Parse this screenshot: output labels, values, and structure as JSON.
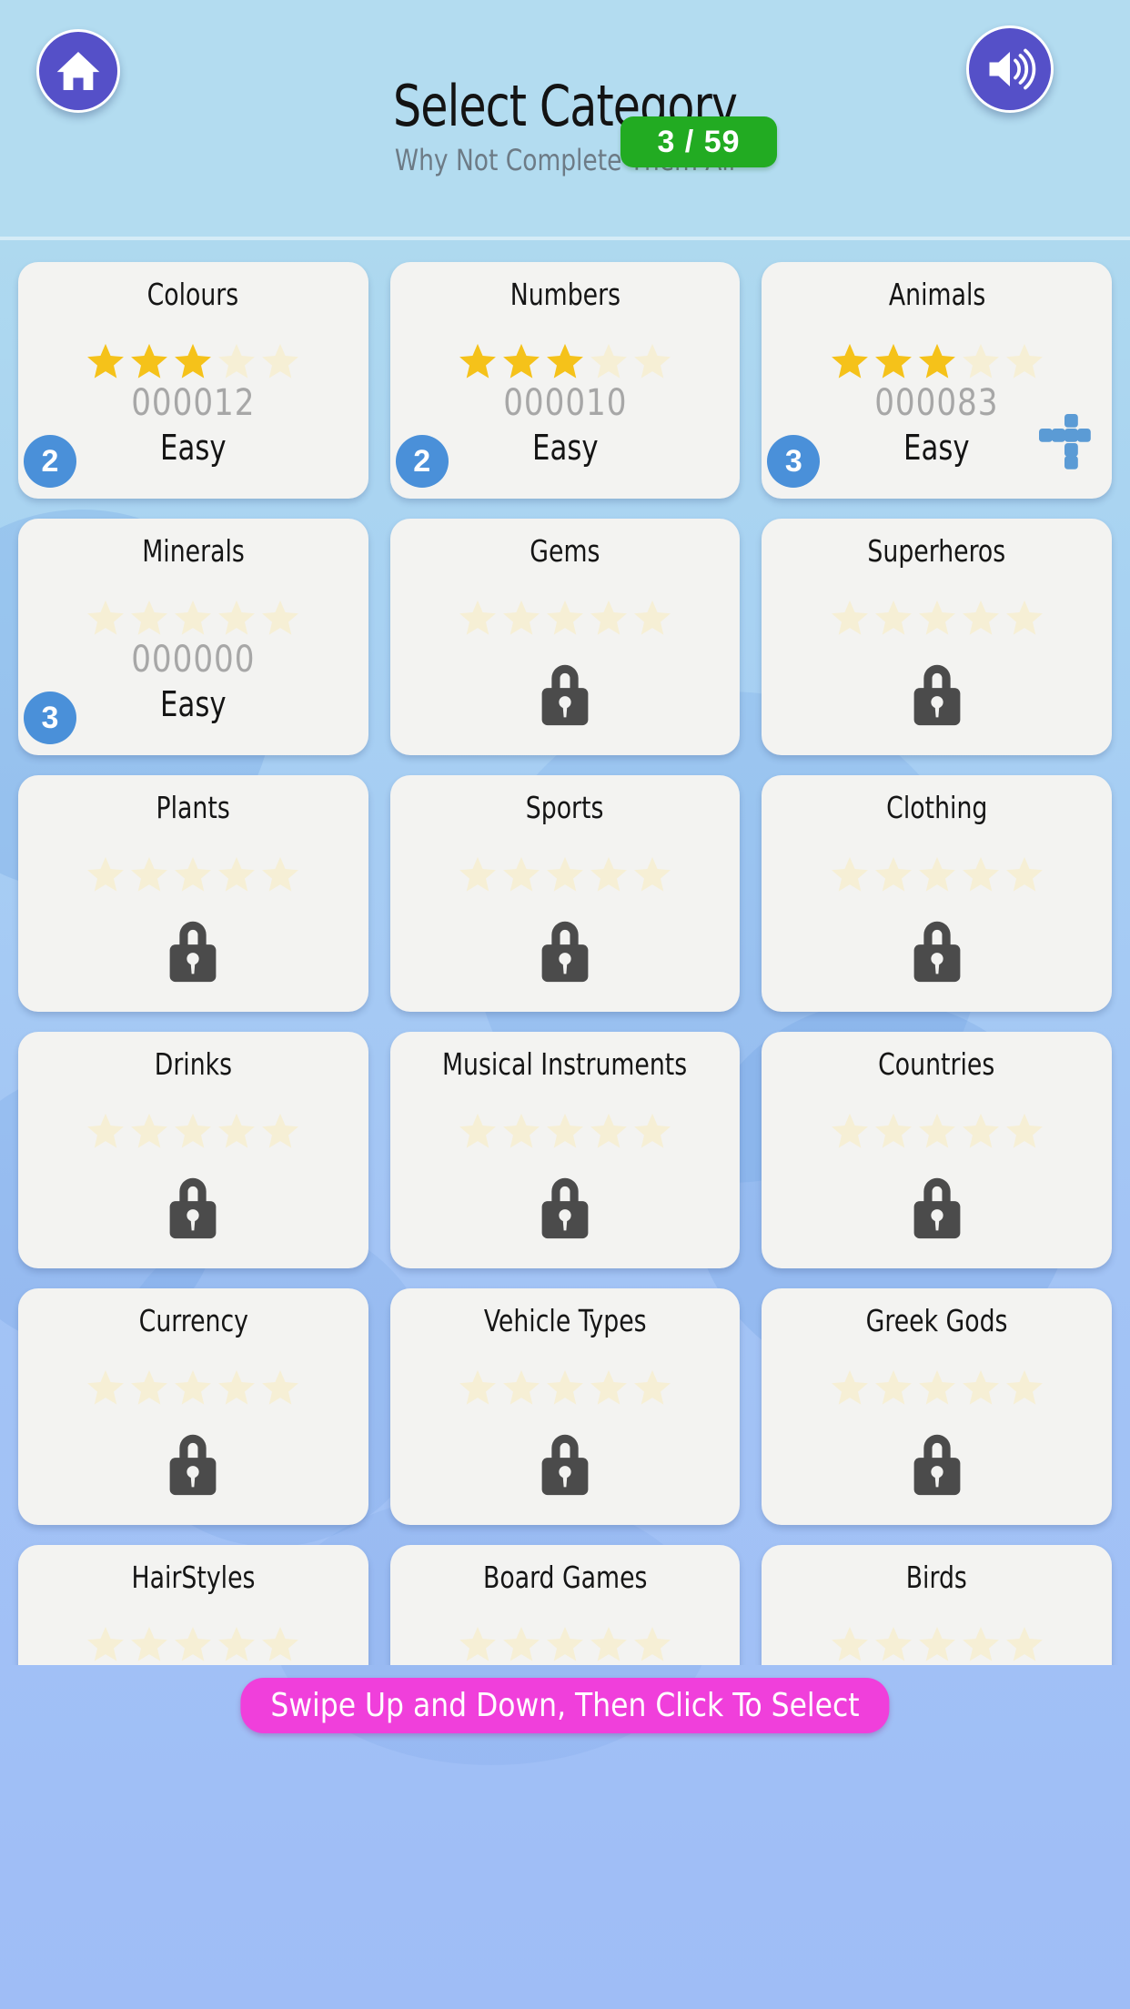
{
  "header": {
    "title": "Select Category",
    "subtitle": "Why Not Complete Them All",
    "home_icon": "home-icon",
    "sound_icon": "sound-on-icon",
    "progress": "3 / 59",
    "accent_purple": "#5550c8",
    "accent_green": "#22ab22",
    "background": "#b3dcf0"
  },
  "colors": {
    "card_bg": "#f3f3f1",
    "star_filled": "#f5c21a",
    "star_empty": "#f6efd5",
    "badge_blue": "#4a90d9",
    "lock_gray": "#4b4b4b",
    "puzzle_blue": "#5b9bd5",
    "banner_pink": "#f03fdb"
  },
  "cards": [
    {
      "title": "Colours",
      "locked": false,
      "stars": 3,
      "score": "000012",
      "difficulty": "Easy",
      "level": "2",
      "puzzle": false
    },
    {
      "title": "Numbers",
      "locked": false,
      "stars": 3,
      "score": "000010",
      "difficulty": "Easy",
      "level": "2",
      "puzzle": false
    },
    {
      "title": "Animals",
      "locked": false,
      "stars": 3,
      "score": "000083",
      "difficulty": "Easy",
      "level": "3",
      "puzzle": true
    },
    {
      "title": "Minerals",
      "locked": false,
      "stars": 0,
      "score": "000000",
      "difficulty": "Easy",
      "level": "3",
      "puzzle": false
    },
    {
      "title": "Gems",
      "locked": true,
      "stars": 0,
      "score": "",
      "difficulty": "",
      "level": "",
      "puzzle": false
    },
    {
      "title": "Superheros",
      "locked": true,
      "stars": 0,
      "score": "",
      "difficulty": "",
      "level": "",
      "puzzle": false
    },
    {
      "title": "Plants",
      "locked": true,
      "stars": 0,
      "score": "",
      "difficulty": "",
      "level": "",
      "puzzle": false
    },
    {
      "title": "Sports",
      "locked": true,
      "stars": 0,
      "score": "",
      "difficulty": "",
      "level": "",
      "puzzle": false
    },
    {
      "title": "Clothing",
      "locked": true,
      "stars": 0,
      "score": "",
      "difficulty": "",
      "level": "",
      "puzzle": false
    },
    {
      "title": "Drinks",
      "locked": true,
      "stars": 0,
      "score": "",
      "difficulty": "",
      "level": "",
      "puzzle": false
    },
    {
      "title": "Musical Instruments",
      "locked": true,
      "stars": 0,
      "score": "",
      "difficulty": "",
      "level": "",
      "puzzle": false
    },
    {
      "title": "Countries",
      "locked": true,
      "stars": 0,
      "score": "",
      "difficulty": "",
      "level": "",
      "puzzle": false
    },
    {
      "title": "Currency",
      "locked": true,
      "stars": 0,
      "score": "",
      "difficulty": "",
      "level": "",
      "puzzle": false
    },
    {
      "title": "Vehicle Types",
      "locked": true,
      "stars": 0,
      "score": "",
      "difficulty": "",
      "level": "",
      "puzzle": false
    },
    {
      "title": "Greek Gods",
      "locked": true,
      "stars": 0,
      "score": "",
      "difficulty": "",
      "level": "",
      "puzzle": false
    },
    {
      "title": "HairStyles",
      "locked": true,
      "stars": 0,
      "score": "",
      "difficulty": "",
      "level": "",
      "puzzle": false
    },
    {
      "title": "Board Games",
      "locked": true,
      "stars": 0,
      "score": "",
      "difficulty": "",
      "level": "",
      "puzzle": false
    },
    {
      "title": "Birds",
      "locked": true,
      "stars": 0,
      "score": "",
      "difficulty": "",
      "level": "",
      "puzzle": false
    }
  ],
  "footer": {
    "hint": "Swipe Up and Down, Then Click To Select"
  },
  "stars_per_card": 5
}
